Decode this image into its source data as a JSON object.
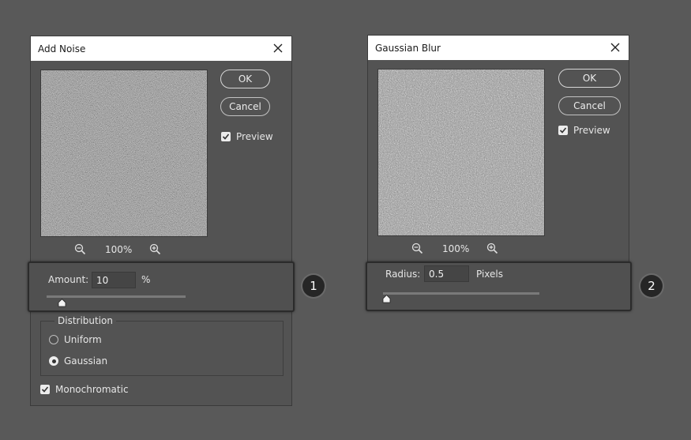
{
  "add_noise": {
    "title": "Add Noise",
    "ok_label": "OK",
    "cancel_label": "Cancel",
    "preview_label": "Preview",
    "preview_checked": true,
    "zoom": "100%",
    "amount_label": "Amount:",
    "amount_value": "10",
    "amount_unit": "%",
    "amount_slider_fraction": 0.1,
    "distribution_label": "Distribution",
    "distribution_options": [
      "Uniform",
      "Gaussian"
    ],
    "distribution_selected": "Gaussian",
    "monochromatic_label": "Monochromatic",
    "monochromatic_checked": true
  },
  "gaussian_blur": {
    "title": "Gaussian Blur",
    "ok_label": "OK",
    "cancel_label": "Cancel",
    "preview_label": "Preview",
    "preview_checked": true,
    "zoom": "100%",
    "radius_label": "Radius:",
    "radius_value": "0.5",
    "radius_unit": "Pixels"
  },
  "callouts": [
    "1",
    "2"
  ],
  "colors": {
    "background": "#595959",
    "dialog": "#535353",
    "titlebar": "#ffffff",
    "callout": "#262626"
  },
  "icons": [
    "close-icon",
    "zoom-out-icon",
    "zoom-in-icon",
    "checkmark-icon",
    "slider-thumb-icon"
  ]
}
